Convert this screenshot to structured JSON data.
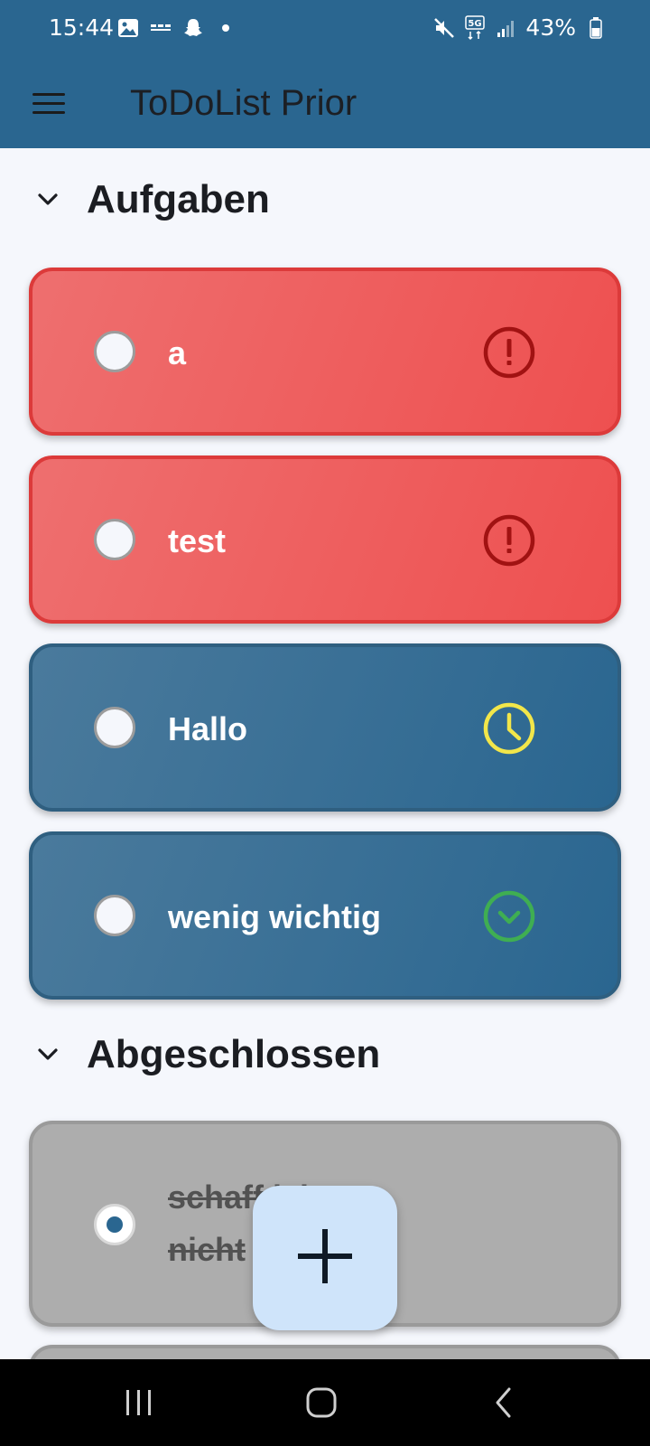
{
  "status_bar": {
    "time": "15:44",
    "battery_text": "43%",
    "network_badge": "5G",
    "left_icons": [
      "gallery-icon",
      "app-notification-icon",
      "snapchat-icon",
      "dot-icon"
    ],
    "right_icons": [
      "mute-icon",
      "network-5g-icon",
      "signal-icon",
      "battery-icon"
    ]
  },
  "app_bar": {
    "title": "ToDoList Prior",
    "menu_icon": "hamburger-menu-icon"
  },
  "sections": {
    "open": {
      "title": "Aufgaben",
      "icon": "chevron-down-icon"
    },
    "done": {
      "title": "Abgeschlossen",
      "icon": "chevron-down-icon"
    }
  },
  "tasks": [
    {
      "label": "a",
      "priority": "high",
      "priority_icon": "alert-circle-icon",
      "checked": false
    },
    {
      "label": "test",
      "priority": "high",
      "priority_icon": "alert-circle-icon",
      "checked": false
    },
    {
      "label": "Hallo",
      "priority": "medium",
      "priority_icon": "clock-icon",
      "checked": false
    },
    {
      "label": "wenig wichtig",
      "priority": "low",
      "priority_icon": "chevron-circle-down-icon",
      "checked": false
    }
  ],
  "completed_tasks": [
    {
      "label_line1": "schaff ich",
      "label_line2": "nicht",
      "checked": true
    }
  ],
  "fab": {
    "icon": "plus-icon"
  },
  "nav_bar": {
    "buttons": [
      "recent-apps-icon",
      "home-icon",
      "back-icon"
    ]
  },
  "colors": {
    "primary": "#2a6690",
    "high_priority": "#ee5a5a",
    "high_icon": "#a11212",
    "medium_icon": "#f2e64a",
    "low_icon": "#3fae52",
    "done_card": "#adadad",
    "fab": "#cfe4fa",
    "background": "#f5f7fc"
  }
}
